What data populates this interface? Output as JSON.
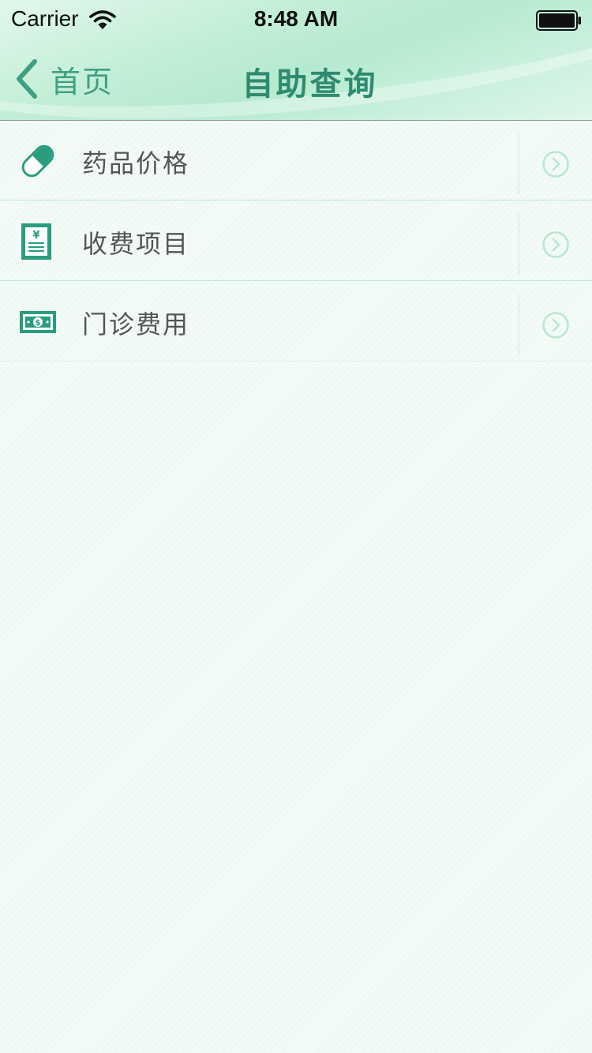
{
  "status_bar": {
    "carrier": "Carrier",
    "time": "8:48 AM"
  },
  "nav": {
    "back_label": "首页",
    "title": "自助查询"
  },
  "colors": {
    "accent": "#2e8a70",
    "accent_light": "#3f9f84",
    "icon_teal": "#2a9c80",
    "arrow_circle": "#b7e6d3"
  },
  "menu": {
    "items": [
      {
        "label": "药品价格",
        "icon": "pill-icon"
      },
      {
        "label": "收费项目",
        "icon": "receipt-icon"
      },
      {
        "label": "门诊费用",
        "icon": "money-icon"
      }
    ]
  }
}
